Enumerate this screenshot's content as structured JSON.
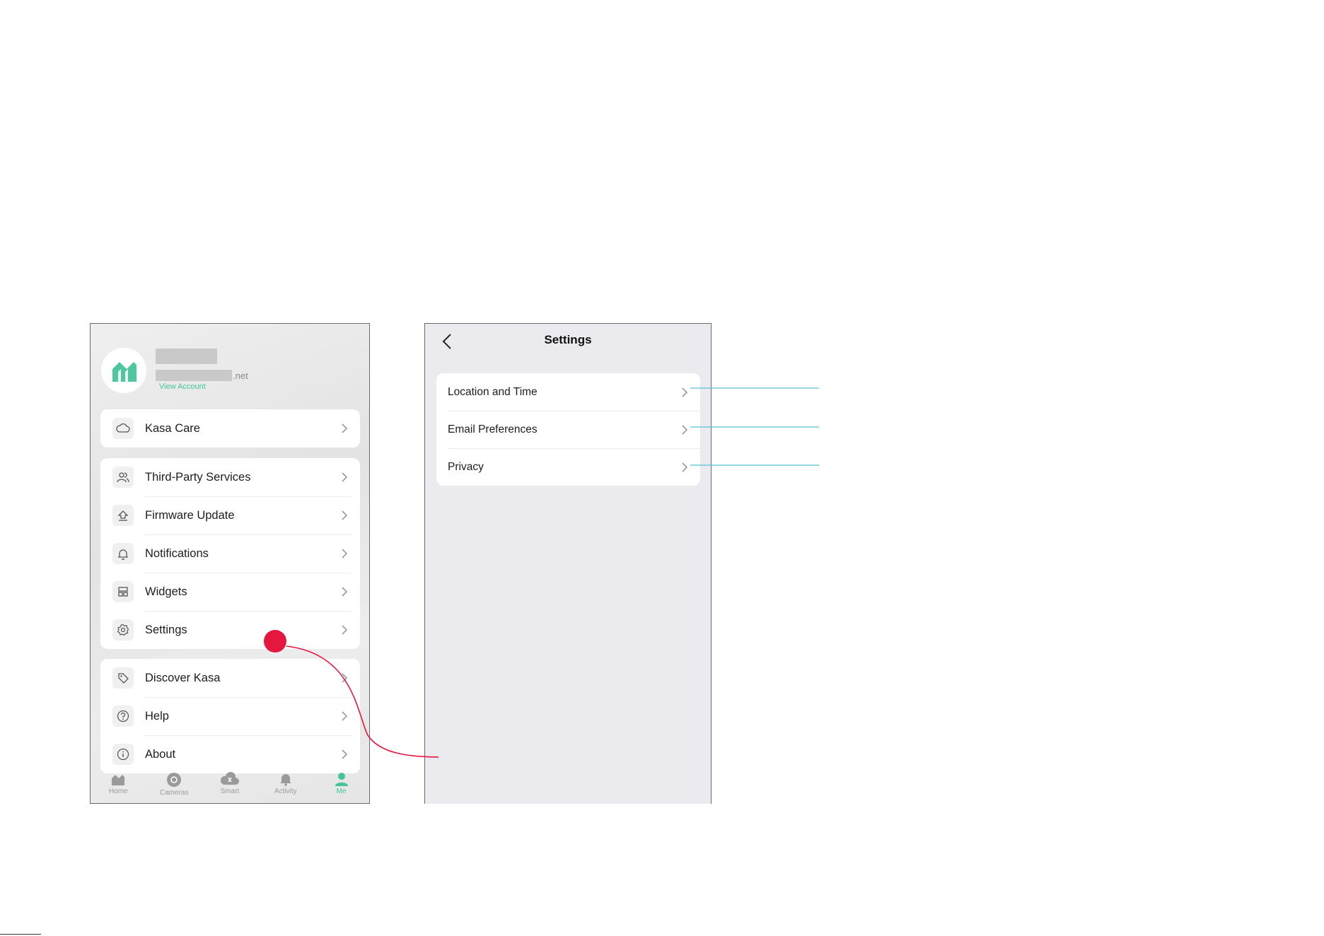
{
  "me_screen": {
    "email_suffix": ".net",
    "view_account": "View Account",
    "sections": [
      {
        "items": [
          {
            "label": "Kasa Care",
            "icon": "cloud-icon"
          }
        ]
      },
      {
        "items": [
          {
            "label": "Third-Party Services",
            "icon": "users-icon"
          },
          {
            "label": "Firmware Update",
            "icon": "upload-icon"
          },
          {
            "label": "Notifications",
            "icon": "bell-icon"
          },
          {
            "label": "Widgets",
            "icon": "widgets-icon"
          },
          {
            "label": "Settings",
            "icon": "gear-icon"
          }
        ]
      },
      {
        "items": [
          {
            "label": "Discover Kasa",
            "icon": "tag-icon"
          },
          {
            "label": "Help",
            "icon": "help-icon"
          },
          {
            "label": "About",
            "icon": "info-icon"
          }
        ]
      }
    ],
    "tabs": [
      {
        "label": "Home",
        "icon": "home-icon",
        "active": false
      },
      {
        "label": "Cameras",
        "icon": "camera-icon",
        "active": false
      },
      {
        "label": "Smart",
        "icon": "smart-icon",
        "active": false
      },
      {
        "label": "Activity",
        "icon": "bell-icon",
        "active": false
      },
      {
        "label": "Me",
        "icon": "person-icon",
        "active": true
      }
    ]
  },
  "settings_screen": {
    "title": "Settings",
    "items": [
      {
        "label": "Location and Time"
      },
      {
        "label": "Email Preferences"
      },
      {
        "label": "Privacy"
      }
    ]
  },
  "colors": {
    "accent": "#43c49a",
    "marker": "#e5173f",
    "callout_line": "#5bc0d6"
  }
}
